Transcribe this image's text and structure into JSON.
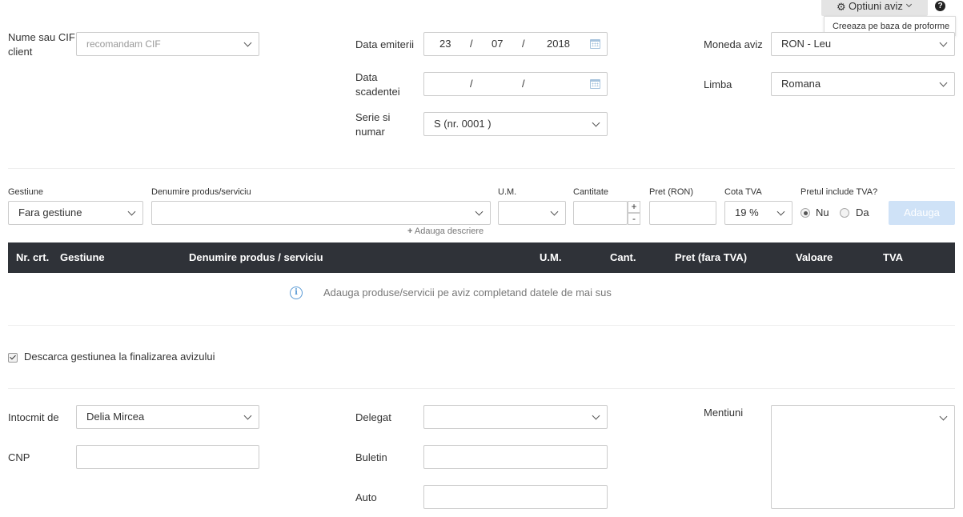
{
  "header": {
    "options_label": "Optiuni aviz",
    "dropdown_item": "Creeaza pe baza de proforme"
  },
  "client": {
    "label": "Nume sau CIF client",
    "placeholder": "recomandam CIF"
  },
  "issue_date": {
    "label": "Data emiterii",
    "day": "23",
    "month": "07",
    "year": "2018",
    "sep": "/"
  },
  "due_date": {
    "label": "Data scadentei",
    "sep": "/"
  },
  "series": {
    "label": "Serie si numar",
    "value": "S (nr. 0001 )"
  },
  "currency": {
    "label": "Moneda aviz",
    "value": "RON - Leu"
  },
  "language": {
    "label": "Limba",
    "value": "Romana"
  },
  "product_form": {
    "gestiune_label": "Gestiune",
    "gestiune_value": "Fara gestiune",
    "product_label": "Denumire produs/serviciu",
    "um_label": "U.M.",
    "qty_label": "Cantitate",
    "plus": "+",
    "minus": "-",
    "price_label": "Pret (RON)",
    "vat_label": "Cota TVA",
    "vat_value": "19 %",
    "incl_vat_label": "Pretul include TVA?",
    "no_label": "Nu",
    "yes_label": "Da",
    "add_button": "Adauga",
    "add_description": "Adauga descriere"
  },
  "table": {
    "columns": [
      "Nr. crt.",
      "Gestiune",
      "Denumire produs / serviciu",
      "U.M.",
      "Cant.",
      "Pret (fara TVA)",
      "Valoare",
      "TVA"
    ],
    "empty_message": "Adauga produse/servicii pe aviz completand datele de mai sus"
  },
  "discharge": {
    "label": "Descarca gestiunea la finalizarea avizului",
    "checked": true
  },
  "footer": {
    "prepared_by_label": "Intocmit de",
    "prepared_by_value": "Delia Mircea",
    "cnp_label": "CNP",
    "delegate_label": "Delegat",
    "id_card_label": "Buletin",
    "car_label": "Auto",
    "notes_label": "Mentiuni"
  },
  "colors": {
    "table_header_bg": "#2f3238",
    "add_button_bg": "#cfe2f7",
    "info_icon": "#5b9bd5"
  }
}
